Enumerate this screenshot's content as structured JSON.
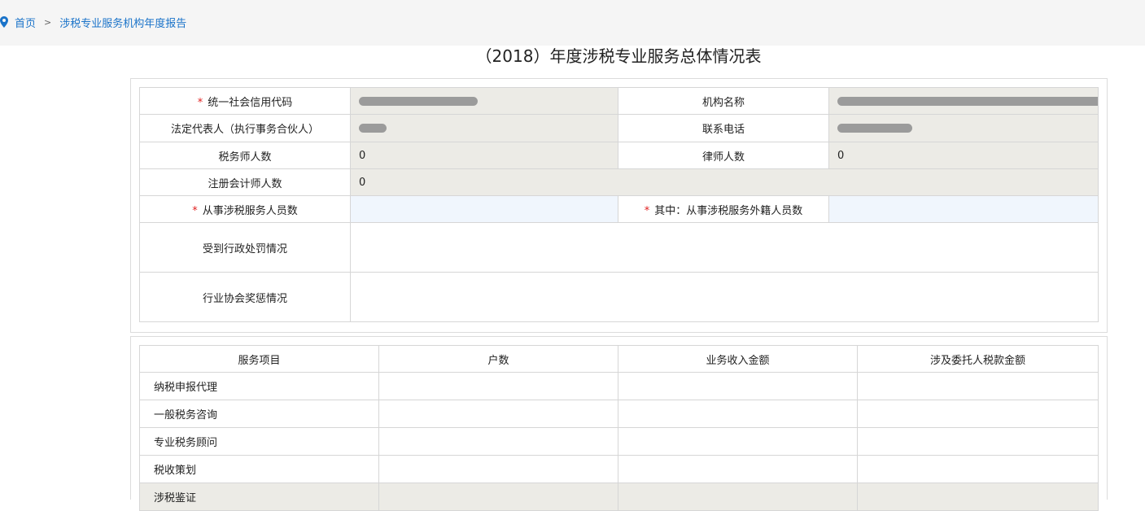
{
  "breadcrumb": {
    "home": "首页",
    "separator": ">",
    "current": "涉税专业服务机构年度报告"
  },
  "page_title": "（2018）年度涉税专业服务总体情况表",
  "info_table": {
    "credit_code_label": "统一社会信用代码",
    "org_name_label": "机构名称",
    "legal_rep_label": "法定代表人（执行事务合伙人）",
    "phone_label": "联系电话",
    "tax_agent_count_label": "税务师人数",
    "tax_agent_count": "0",
    "lawyer_count_label": "律师人数",
    "lawyer_count": "0",
    "cpa_count_label": "注册会计师人数",
    "cpa_count": "0",
    "staff_count_label": "从事涉税服务人员数",
    "foreign_staff_label": "其中：从事涉税服务外籍人员数",
    "penalty_label": "受到行政处罚情况",
    "award_label": "行业协会奖惩情况",
    "required_mark": "*"
  },
  "service_table": {
    "headers": [
      "服务项目",
      "户数",
      "业务收入金额",
      "涉及委托人税款金额"
    ],
    "rows": [
      "纳税申报代理",
      "一般税务咨询",
      "专业税务顾问",
      "税收策划",
      "涉税鉴证"
    ]
  },
  "colors": {
    "link": "#1a73c9",
    "required": "#e02020",
    "readonly_bg": "#ecebe6",
    "input_bg": "#f0f6fd"
  }
}
